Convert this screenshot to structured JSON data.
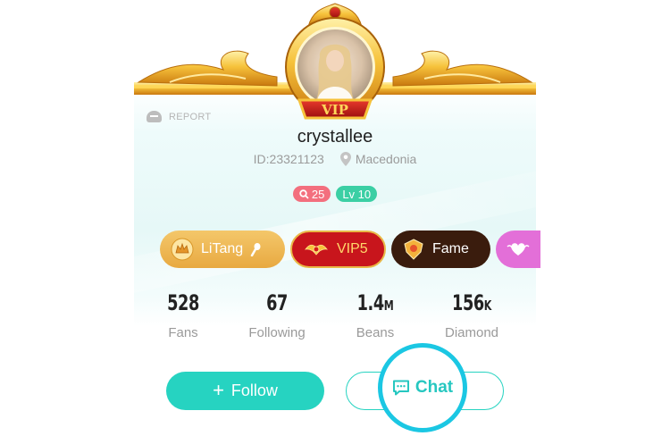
{
  "header": {
    "vip_crest_label": "VIP",
    "report_label": "REPORT"
  },
  "profile": {
    "username": "crystallee",
    "id_text": "ID:23321123",
    "location": "Macedonia"
  },
  "badges": [
    {
      "icon": "search-icon",
      "value": "25"
    },
    {
      "label": "Lv 10"
    }
  ],
  "chips": [
    {
      "label": "LiTang",
      "icon": "crown-icon"
    },
    {
      "label": "VIP5",
      "icon": "vip-wings-icon"
    },
    {
      "label": "Fame",
      "icon": "fame-shield-icon"
    },
    {
      "label": "",
      "icon": "heart-wings-icon"
    }
  ],
  "stats": [
    {
      "value": "528",
      "unit": "",
      "label": "Fans"
    },
    {
      "value": "67",
      "unit": "",
      "label": "Following"
    },
    {
      "value": "1.4",
      "unit": "M",
      "label": "Beans"
    },
    {
      "value": "156",
      "unit": "K",
      "label": "Diamond"
    }
  ],
  "actions": {
    "follow_label": "Follow",
    "chat_label": "Chat"
  },
  "colors": {
    "accent": "#26d3c1",
    "highlight_ring": "#1bc7e3",
    "gold": "#e8a941",
    "vip_red": "#c8151c"
  }
}
